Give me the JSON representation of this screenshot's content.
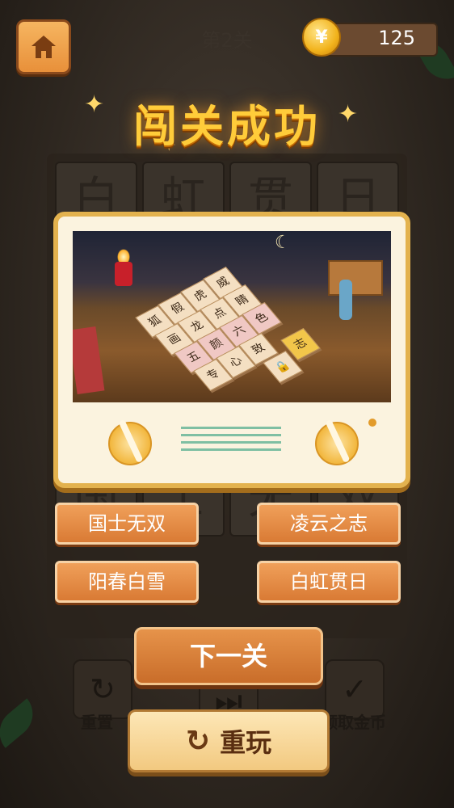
{
  "header": {
    "level": "第2关",
    "coins": "125",
    "coin_symbol": "¥"
  },
  "title": "闯关成功",
  "background_board": {
    "tiles": [
      "白",
      "虹",
      "贯",
      "日",
      "国",
      "士",
      "无",
      "双"
    ]
  },
  "picture": {
    "tiles": [
      "狐",
      "假",
      "虎",
      "威",
      "画",
      "龙",
      "点",
      "睛",
      "五",
      "颜",
      "六",
      "色",
      "专",
      "心",
      "致",
      "志"
    ]
  },
  "answers": [
    "国士无双",
    "凌云之志",
    "阳春白雪",
    "白虹贯日"
  ],
  "buttons": {
    "next": "下一关",
    "replay": "重玩"
  },
  "background_controls": {
    "reset": "重置",
    "get_coins": "领取金币"
  },
  "colors": {
    "accent": "#e8903a",
    "title": "#ffcc3a",
    "card_border": "#e3b24e"
  }
}
